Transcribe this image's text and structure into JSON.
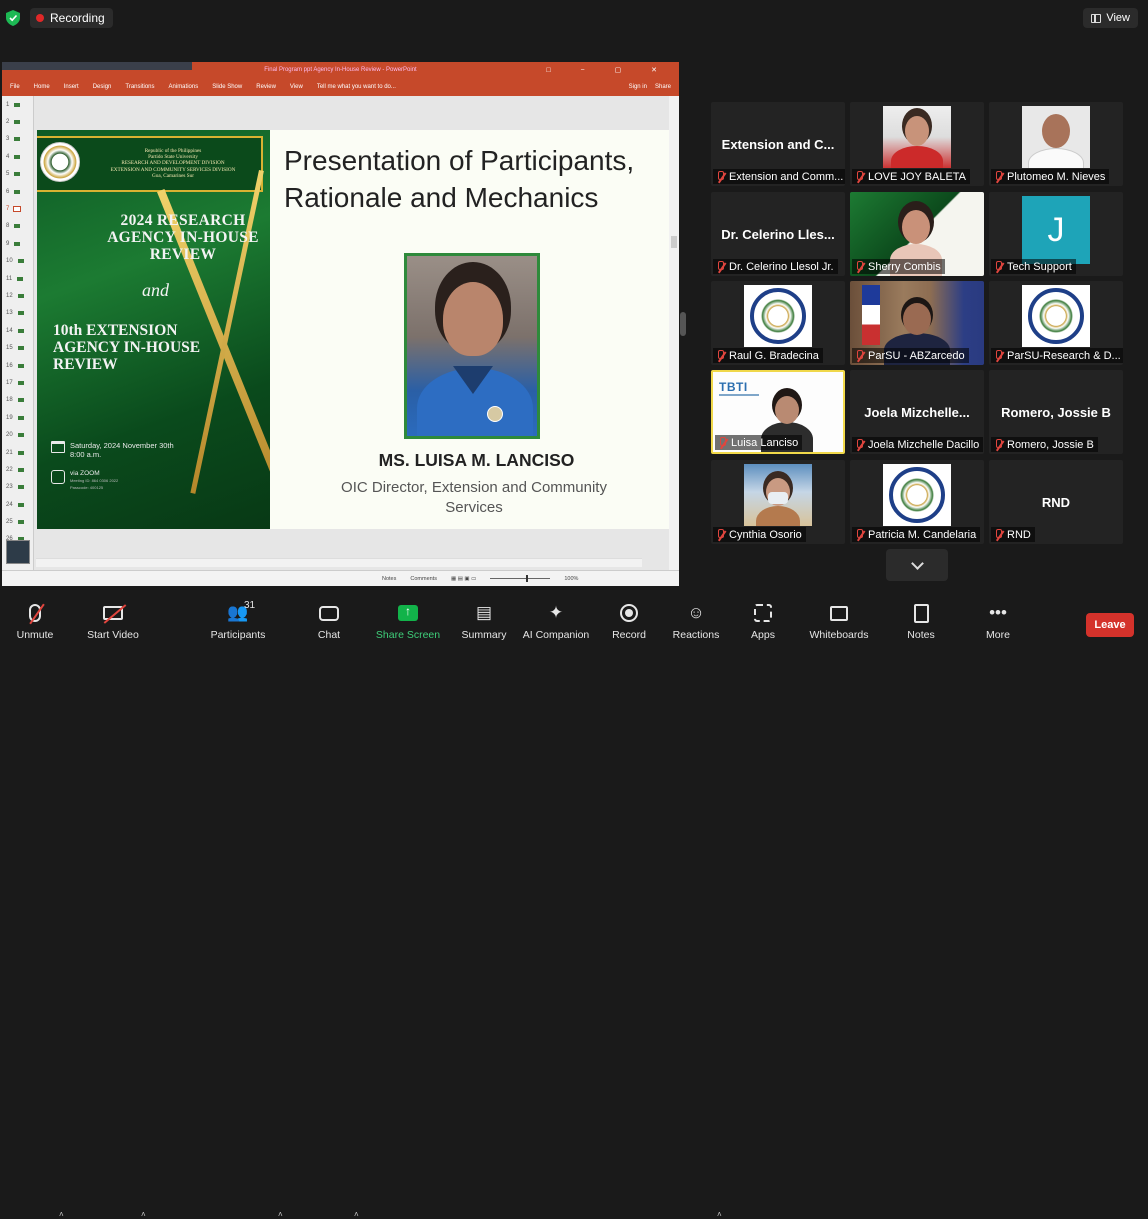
{
  "topbar": {
    "recording_label": "Recording",
    "view_label": "View"
  },
  "presentation": {
    "window_title": "Final Program ppt Agency In-House Review - PowerPoint",
    "ribbon_tabs": [
      "File",
      "Home",
      "Insert",
      "Design",
      "Transitions",
      "Animations",
      "Slide Show",
      "Review",
      "View",
      "Tell me what you want to do..."
    ],
    "ribbon_right": [
      "Sign in",
      "Share"
    ],
    "slide_numbers": [
      "1",
      "2",
      "3",
      "4",
      "5",
      "6",
      "7",
      "8",
      "9",
      "10",
      "11",
      "12",
      "13",
      "14",
      "15",
      "16",
      "17",
      "18",
      "19",
      "20",
      "21",
      "22",
      "23",
      "24",
      "25",
      "26"
    ],
    "active_slide_index": 6,
    "status_items": [
      "Notes",
      "Comments",
      "100%"
    ],
    "slide": {
      "banner_lines": [
        "Republic of the Philippines",
        "Partido State University",
        "RESEARCH AND DEVELOPMENT DIVISION",
        "EXTENSION AND COMMUNITY SERVICES DIVISION",
        "Goa, Camarines Sur"
      ],
      "event_title_1": "2024 RESEARCH AGENCY IN-HOUSE REVIEW",
      "event_and": "and",
      "event_title_2": "10th EXTENSION AGENCY IN-HOUSE REVIEW",
      "event_date": "Saturday, 2024 November 30th",
      "event_time": "8:00 a.m.",
      "event_via": "via ZOOM",
      "event_meeting": "Meeting ID: 864 0306 2022",
      "event_passcode": "Passcode: 400125",
      "heading": "Presentation of Participants, Rationale and Mechanics",
      "presenter_name": "MS. LUISA M. LANCISO",
      "presenter_role": "OIC Director, Extension and Community Services"
    }
  },
  "gallery": [
    {
      "display": "Extension and C...",
      "label": "Extension and Comm...",
      "video": "none"
    },
    {
      "display": "",
      "label": "LOVE JOY BALETA",
      "video": "person-red"
    },
    {
      "display": "",
      "label": "Plutomeo M. Nieves",
      "video": "man"
    },
    {
      "display": "Dr. Celerino Lles...",
      "label": "Dr. Celerino Llesol Jr.",
      "video": "none"
    },
    {
      "display": "",
      "label": "Sherry Combis",
      "video": "slide"
    },
    {
      "display": "",
      "label": "Tech Support",
      "video": "avatar-J",
      "avatar_letter": "J"
    },
    {
      "display": "",
      "label": "Raul G. Bradecina",
      "video": "seal"
    },
    {
      "display": "",
      "label": "ParSU - ABZarcedo",
      "video": "office"
    },
    {
      "display": "",
      "label": "ParSU-Research & D...",
      "video": "seal"
    },
    {
      "display": "",
      "label": "Luisa Lanciso",
      "video": "luisa",
      "logo": "TBTI",
      "active": true
    },
    {
      "display": "Joela Mizchelle...",
      "label": "Joela Mizchelle Dacillo",
      "video": "none"
    },
    {
      "display": "Romero, Jossie B",
      "label": "Romero, Jossie B",
      "video": "none"
    },
    {
      "display": "",
      "label": "Cynthia Osorio",
      "video": "masked"
    },
    {
      "display": "",
      "label": "Patricia M. Candelaria",
      "video": "seal"
    },
    {
      "display": "RND",
      "label": "RND",
      "video": "none"
    }
  ],
  "toolbar": {
    "unmute": "Unmute",
    "start_video": "Start Video",
    "participants": "Participants",
    "participants_count": "31",
    "chat": "Chat",
    "share_screen": "Share Screen",
    "summary": "Summary",
    "ai_companion": "AI Companion",
    "record": "Record",
    "reactions": "Reactions",
    "apps": "Apps",
    "whiteboards": "Whiteboards",
    "notes": "Notes",
    "more": "More",
    "leave": "Leave"
  },
  "colors": {
    "accent_green": "#12b34a",
    "leave_red": "#d4322b",
    "active_speaker": "#f0d84a",
    "ppt_orange": "#c6492a"
  }
}
